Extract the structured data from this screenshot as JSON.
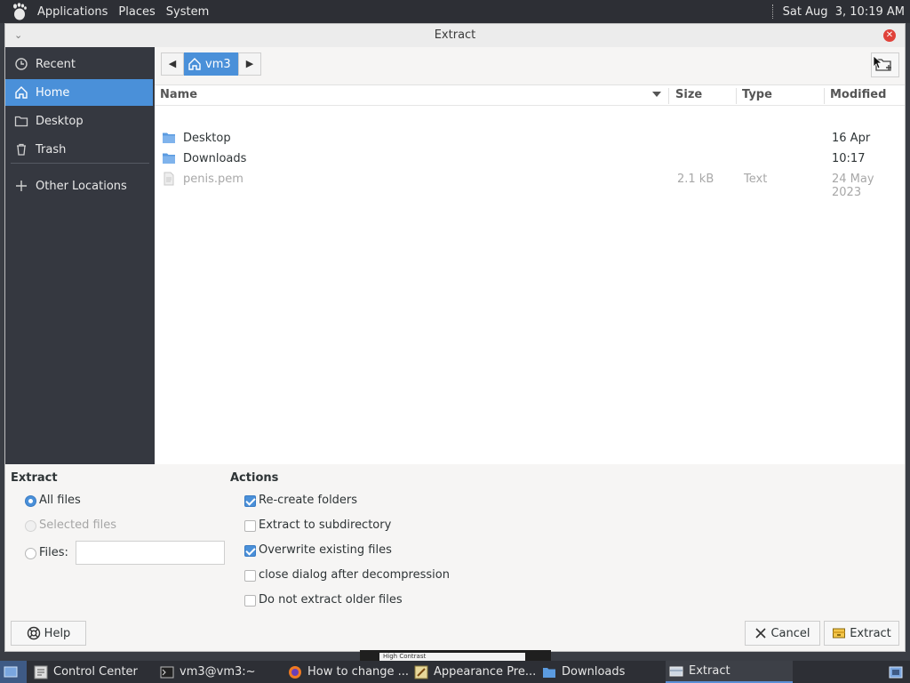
{
  "top_panel": {
    "menus": [
      "Applications",
      "Places",
      "System"
    ],
    "clock": "Sat Aug  3, 10:19 AM"
  },
  "dialog": {
    "title": "Extract",
    "sidebar": {
      "items": [
        {
          "label": "Recent",
          "icon": "clock-icon"
        },
        {
          "label": "Home",
          "icon": "home-icon",
          "selected": true
        },
        {
          "label": "Desktop",
          "icon": "folder-icon"
        },
        {
          "label": "Trash",
          "icon": "trash-icon"
        },
        {
          "label": "Other Locations",
          "icon": "plus-icon"
        }
      ]
    },
    "pathbar": {
      "current": "vm3"
    },
    "columns": {
      "name": "Name",
      "size": "Size",
      "type": "Type",
      "modified": "Modified"
    },
    "files": [
      {
        "name": "Desktop",
        "size": "",
        "type": "",
        "modified": "16 Apr",
        "kind": "folder"
      },
      {
        "name": "Downloads",
        "size": "",
        "type": "",
        "modified": "10:17",
        "kind": "folder"
      },
      {
        "name": "penis.pem",
        "size": "2.1 kB",
        "type": "Text",
        "modified": "24 May 2023",
        "kind": "file"
      }
    ],
    "extract_group": {
      "title": "Extract",
      "all_files": "All files",
      "selected_files": "Selected files",
      "files_label": "Files:",
      "files_value": ""
    },
    "actions_group": {
      "title": "Actions",
      "options": [
        {
          "label": "Re-create folders",
          "checked": true
        },
        {
          "label": "Extract to subdirectory",
          "checked": false
        },
        {
          "label": "Overwrite existing files",
          "checked": true
        },
        {
          "label": "close dialog after decompression",
          "checked": false
        },
        {
          "label": "Do not extract older files",
          "checked": false
        }
      ]
    },
    "buttons": {
      "help": "Help",
      "cancel": "Cancel",
      "extract": "Extract"
    }
  },
  "taskbar": {
    "items": [
      {
        "label": "Control Center"
      },
      {
        "label": "vm3@vm3:~"
      },
      {
        "label": "How to change ..."
      },
      {
        "label": "Appearance Pre..."
      },
      {
        "label": "Downloads"
      },
      {
        "label": "Extract",
        "active": true
      }
    ],
    "peek_label": "High Contrast"
  },
  "colors": {
    "accent": "#4a90d9",
    "sidebar_bg": "#353840",
    "panel_bg": "#2d2f35",
    "close": "#e0423a"
  }
}
